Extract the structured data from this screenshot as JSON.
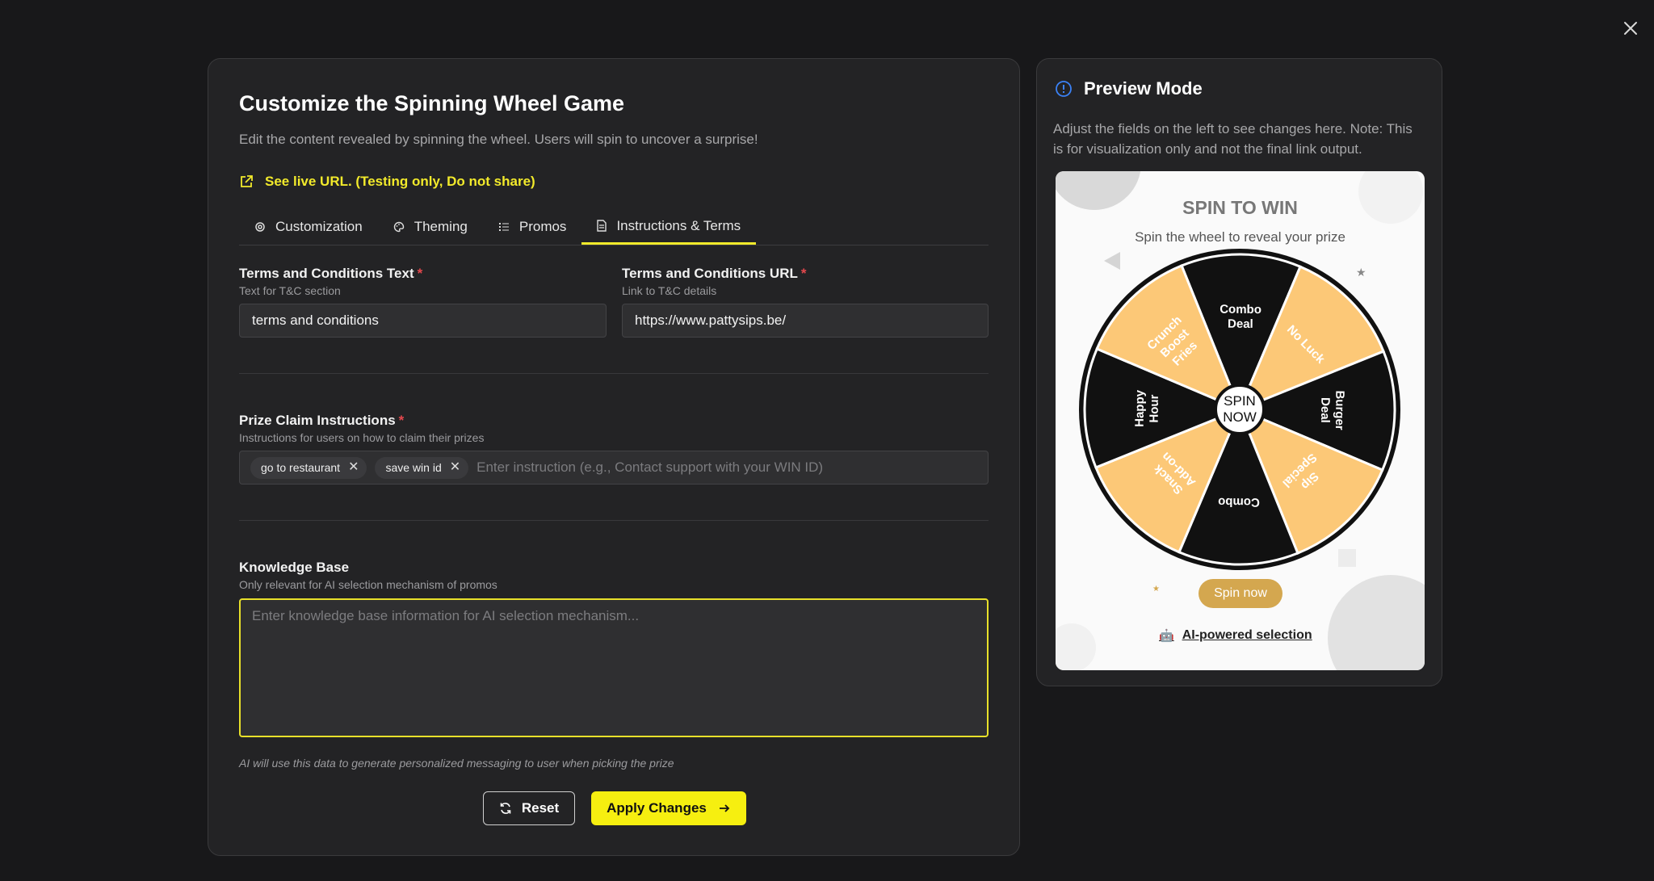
{
  "colors": {
    "accent_yellow": "#f2ea2b",
    "apply_button": "#f6ef10",
    "required_star": "#e5484d",
    "wheel_light": "#fcc877",
    "wheel_dark": "#111111",
    "spin_button": "#d4a74f"
  },
  "editor": {
    "title": "Customize the Spinning Wheel Game",
    "description": "Edit the content revealed by spinning the wheel. Users will spin to uncover a surprise!",
    "live_link": "See live URL. (Testing only, Do not share)",
    "tabs": [
      {
        "label": "Customization",
        "icon": "gear-icon"
      },
      {
        "label": "Theming",
        "icon": "palette-icon"
      },
      {
        "label": "Promos",
        "icon": "list-icon"
      },
      {
        "label": "Instructions & Terms",
        "icon": "document-icon",
        "active": true
      }
    ],
    "terms_text": {
      "label": "Terms and Conditions Text",
      "required": "*",
      "help": "Text for T&C section",
      "value": "terms and conditions"
    },
    "terms_url": {
      "label": "Terms and Conditions URL",
      "required": "*",
      "help": "Link to T&C details",
      "value": "https://www.pattysips.be/"
    },
    "prize_claim": {
      "label": "Prize Claim Instructions",
      "required": "*",
      "help": "Instructions for users on how to claim their prizes",
      "tags": [
        "go to restaurant",
        "save win id"
      ],
      "placeholder": "Enter instruction (e.g., Contact support with your WIN ID)"
    },
    "knowledge_base": {
      "label": "Knowledge Base",
      "help": "Only relevant for AI selection mechanism of promos",
      "placeholder": "Enter knowledge base information for AI selection mechanism..."
    },
    "ai_note": "AI will use this data to generate personalized messaging to user when picking the prize",
    "reset_label": "Reset",
    "apply_label": "Apply Changes"
  },
  "preview": {
    "title": "Preview Mode",
    "description": "Adjust the fields on the left to see changes here. Note: This is for visualization only and not the final link output.",
    "card_title": "SPIN TO WIN",
    "card_subtitle": "Spin the wheel to reveal your prize",
    "wheel": {
      "center_label_1": "SPIN",
      "center_label_2": "NOW",
      "segments": [
        {
          "label": [
            "Combo",
            "Deal"
          ],
          "shade": "dark"
        },
        {
          "label": [
            "No Luck"
          ],
          "shade": "light"
        },
        {
          "label": [
            "Burger",
            "Deal"
          ],
          "shade": "dark"
        },
        {
          "label": [
            "Sip",
            "Special"
          ],
          "shade": "light"
        },
        {
          "label": [
            "Combo"
          ],
          "shade": "dark"
        },
        {
          "label": [
            "Snack",
            "Add-on"
          ],
          "shade": "light"
        },
        {
          "label": [
            "Happy",
            "Hour"
          ],
          "shade": "dark"
        },
        {
          "label": [
            "Crunch",
            "Boost",
            "Fries"
          ],
          "shade": "light"
        }
      ]
    },
    "spin_button": "Spin now",
    "ai_selection": "AI-powered selection"
  }
}
